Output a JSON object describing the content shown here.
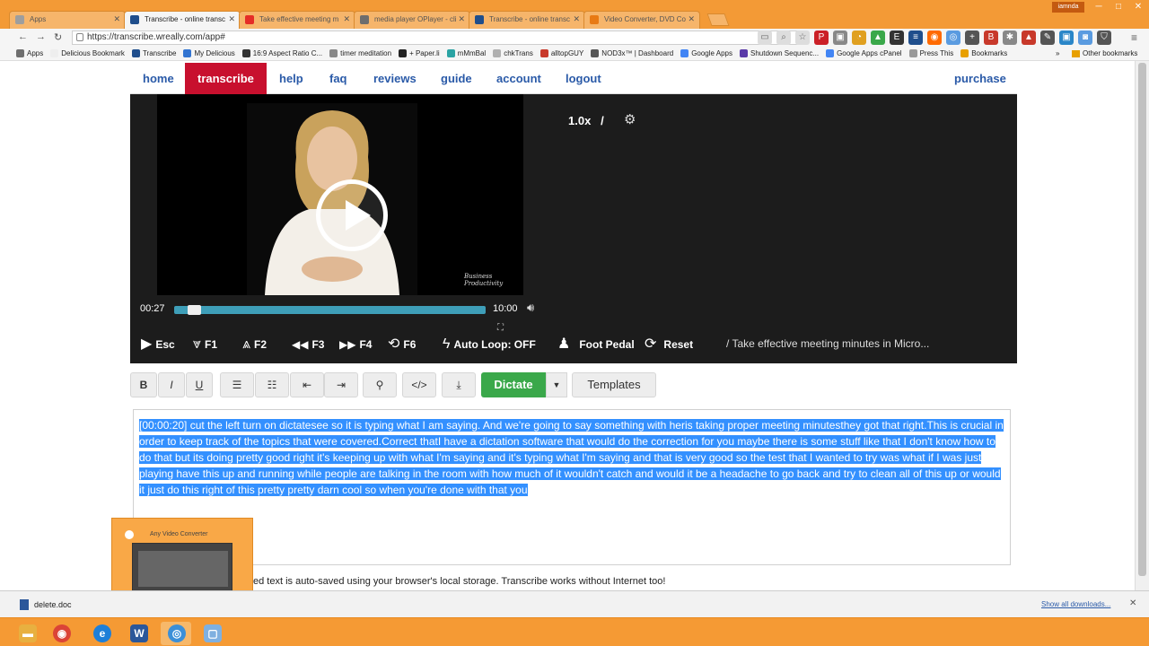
{
  "browser": {
    "tabs": [
      {
        "title": "Apps",
        "icon": "apps-icon",
        "color": "#9e9e9e",
        "active": false
      },
      {
        "title": "Transcribe - online transc",
        "icon": "wreally-icon",
        "color": "#1f4e8c",
        "active": true
      },
      {
        "title": "Take effective meeting m",
        "icon": "youtube-icon",
        "color": "#e52d27",
        "active": false
      },
      {
        "title": "media player OPlayer - cli",
        "icon": "page-icon",
        "color": "#6d6d6d",
        "active": false
      },
      {
        "title": "Transcribe - online transc",
        "icon": "wreally-icon",
        "color": "#1f4e8c",
        "active": false
      },
      {
        "title": "Video Converter, DVD Co",
        "icon": "video-converter-icon",
        "color": "#e87a14",
        "active": false
      }
    ],
    "user": "iamnda",
    "url": "https://transcribe.wreally.com/app#",
    "bookmarks": [
      {
        "label": "Apps",
        "color": "#6f6f6f"
      },
      {
        "label": "Delicious Bookmark",
        "color": "#eeeeee"
      },
      {
        "label": "Transcribe",
        "color": "#1f4e8c"
      },
      {
        "label": "My Delicious",
        "color": "#3274d1"
      },
      {
        "label": "16:9 Aspect Ratio C...",
        "color": "#333333"
      },
      {
        "label": "timer meditation",
        "color": "#888888"
      },
      {
        "label": "+ Paper.li",
        "color": "#222222"
      },
      {
        "label": "mMmBal",
        "color": "#2aa3a3"
      },
      {
        "label": "chkTrans",
        "color": "#b0b0b0"
      },
      {
        "label": "alltopGUY",
        "color": "#c8392b"
      },
      {
        "label": "NOD3x™ | Dashboard",
        "color": "#555555"
      },
      {
        "label": "Google Apps",
        "color": "#4285f4"
      },
      {
        "label": "Shutdown Sequenc...",
        "color": "#5a3aa8"
      },
      {
        "label": "Google Apps cPanel",
        "color": "#4285f4"
      },
      {
        "label": "Press This",
        "color": "#999999"
      },
      {
        "label": "Bookmarks",
        "color": "#e8a000"
      }
    ],
    "bookmarks_overflow": "»",
    "other_bookmarks": "Other bookmarks"
  },
  "nav": {
    "items": [
      "home",
      "transcribe",
      "help",
      "faq",
      "reviews",
      "guide",
      "account",
      "logout"
    ],
    "active": "transcribe",
    "purchase": "purchase"
  },
  "player": {
    "speed": "1.0x",
    "separator": "/",
    "watermark": "Business Productivity",
    "current_time": "00:27",
    "total_time": "10:00",
    "progress": 0.045,
    "controls": [
      {
        "name": "play",
        "icon": "▶",
        "label": "Esc"
      },
      {
        "name": "slow-down",
        "icon": "⩔",
        "label": "F1"
      },
      {
        "name": "speed-up",
        "icon": "⩓",
        "label": "F2"
      },
      {
        "name": "rewind",
        "icon": "◀◀",
        "label": "F3"
      },
      {
        "name": "forward",
        "icon": "▶▶",
        "label": "F4"
      },
      {
        "name": "timestamp",
        "icon": "⟲",
        "label": "F6"
      },
      {
        "name": "auto-loop",
        "icon": "ϟ",
        "label": "Auto Loop: OFF"
      },
      {
        "name": "foot-pedal",
        "icon": "♟",
        "label": "Foot Pedal"
      },
      {
        "name": "reset",
        "icon": "⟳",
        "label": "Reset"
      }
    ],
    "media_title": "/ Take effective meeting minutes in Micro..."
  },
  "toolbar": {
    "bold": "B",
    "italic": "I",
    "underline": "U",
    "dictate": "Dictate",
    "templates": "Templates"
  },
  "editor": {
    "text": "[00:00:20] cut the left turn on dictatesee so it is typing what I am saying. And we're going to say something with heris taking proper meeting minutesthey got that right.This is crucial in order to keep track of the topics that were covered.Correct thatI have a dictation software that would do the correction for you maybe there is some stuff like that I don't know how to do that but its doing pretty good right it's keeping up with what I'm saying and it's typing what I'm saying and that is very good so the test that I wanted to try was what if I was just playing have this up and running while people are talking in the room with how much of it wouldn't catch and would it be a headache to go back and try to clean all of this up or would it just do this right of this pretty pretty darn cool so when you're done with that you"
  },
  "save_note": "ed text is auto-saved using your browser's local storage. Transcribe works without Internet too!",
  "thumbnail": {
    "title": "Any Video Converter"
  },
  "downloads": {
    "file": "delete.doc",
    "show_all": "Show all downloads..."
  },
  "colors": {
    "accent_red": "#c8102e",
    "link_blue": "#2a5aa8",
    "dictate_green": "#3aa84a",
    "selection_blue": "#3390ff",
    "progress_teal": "#3e9eb8",
    "player_bg": "#1c1c1c"
  }
}
